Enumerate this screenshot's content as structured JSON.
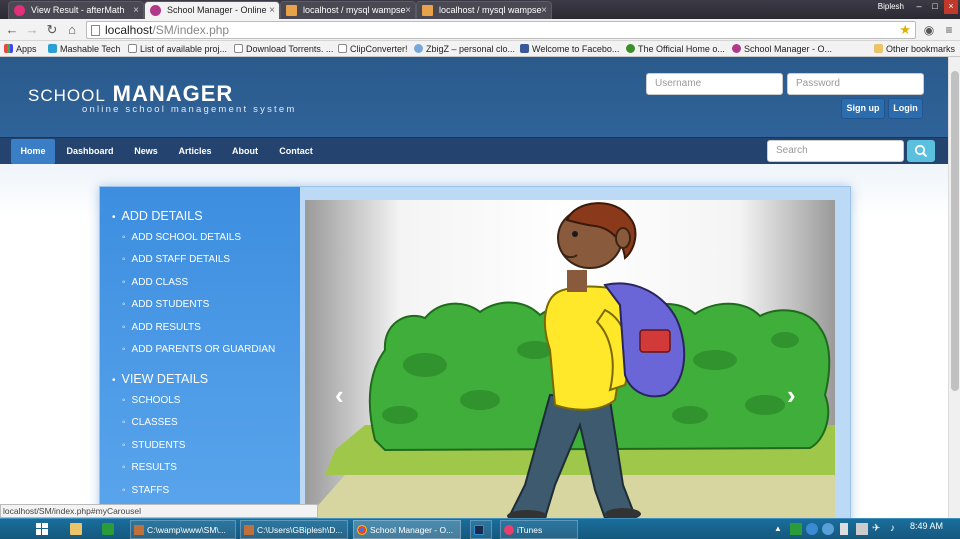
{
  "browser": {
    "tabs": [
      {
        "label": "View Result - afterMath",
        "active": false
      },
      {
        "label": "School Manager - Online",
        "active": true
      },
      {
        "label": "localhost / mysql wampse",
        "active": false
      },
      {
        "label": "localhost / mysql wampse",
        "active": false
      }
    ],
    "user": "Biplesh",
    "url_host": "localhost",
    "url_path": "/SM/index.php",
    "bookmarks": [
      "Apps",
      "Mashable Tech",
      "List of available proj...",
      "Download Torrents. ...",
      "ClipConverter!",
      "ZbigZ – personal clo...",
      "Welcome to Facebo...",
      "The Official Home o...",
      "School Manager - O...",
      "Other bookmarks"
    ],
    "status_url": "localhost/SM/index.php#myCarousel"
  },
  "site": {
    "logo_school": "School",
    "logo_manager": "Manager",
    "tagline": "online school management system",
    "username_placeholder": "Username",
    "password_placeholder": "Password",
    "signup_label": "Sign up",
    "login_label": "Login",
    "nav": [
      "Home",
      "Dashboard",
      "News",
      "Articles",
      "About",
      "Contact"
    ],
    "nav_active": "Home",
    "search_placeholder": "Search"
  },
  "sidebar": {
    "add_heading": "ADD DETAILS",
    "add_items": [
      "ADD SCHOOL DETAILS",
      "ADD STAFF DETAILS",
      "ADD CLASS",
      "ADD STUDENTS",
      "ADD RESULTS",
      "ADD PARENTS OR GUARDIAN"
    ],
    "view_heading": "VIEW DETAILS",
    "view_items": [
      "SCHOOLS",
      "CLASSES",
      "STUDENTS",
      "RESULTS",
      "STAFFS"
    ]
  },
  "carousel": {
    "prev_icon": "chevron-left-icon",
    "next_icon": "chevron-right-icon"
  },
  "taskbar": {
    "apps": [
      "C:\\wamp\\www\\SM\\...",
      "C:\\Users\\GBiplesh\\D...",
      "School Manager - O...",
      "",
      "iTunes"
    ],
    "time": "8:49 AM"
  },
  "colors": {
    "header": "#2f6399",
    "navbar": "#24446f",
    "accent": "#3a7ec6",
    "sidebar": "#3d8ee0",
    "taskbar": "#15587e"
  }
}
